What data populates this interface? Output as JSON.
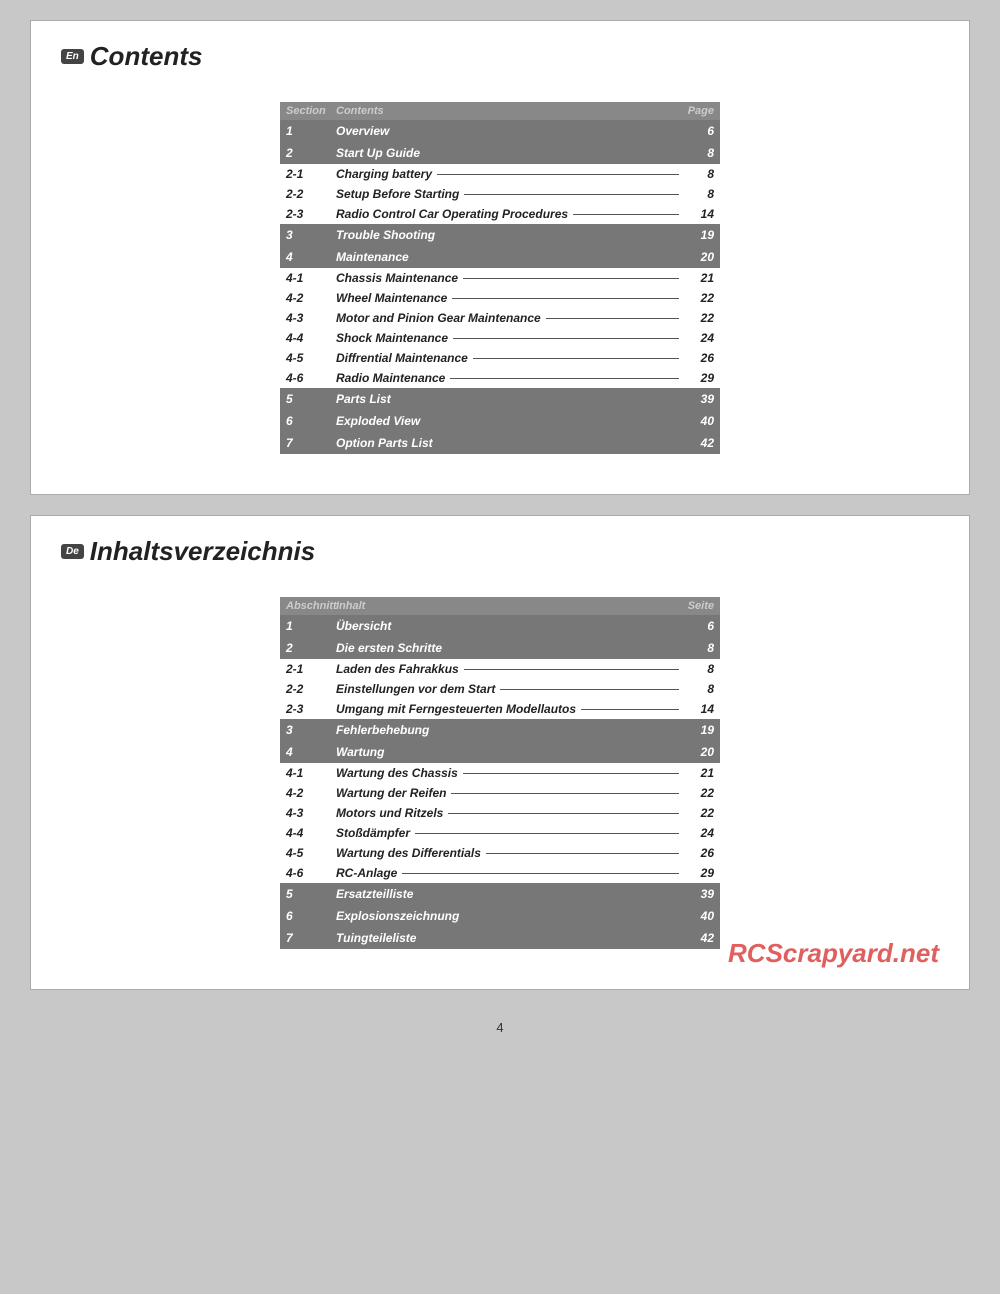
{
  "page_number": "4",
  "english_section": {
    "lang_code": "En",
    "title": "Contents",
    "table": {
      "headers": [
        "Section",
        "Contents",
        "Page"
      ],
      "rows": [
        {
          "section": "1",
          "content": "Overview",
          "page": "6",
          "type": "dark",
          "has_line": false
        },
        {
          "section": "2",
          "content": "Start Up Guide",
          "page": "8",
          "type": "dark",
          "has_line": false
        },
        {
          "section": "2-1",
          "content": "Charging battery",
          "page": "8",
          "type": "light",
          "has_line": true
        },
        {
          "section": "2-2",
          "content": "Setup Before Starting",
          "page": "8",
          "type": "light",
          "has_line": true
        },
        {
          "section": "2-3",
          "content": "Radio Control Car Operating Procedures",
          "page": "14",
          "type": "light",
          "has_line": true
        },
        {
          "section": "3",
          "content": "Trouble Shooting",
          "page": "19",
          "type": "dark",
          "has_line": false
        },
        {
          "section": "4",
          "content": "Maintenance",
          "page": "20",
          "type": "dark",
          "has_line": false
        },
        {
          "section": "4-1",
          "content": "Chassis Maintenance",
          "page": "21",
          "type": "light",
          "has_line": true
        },
        {
          "section": "4-2",
          "content": "Wheel Maintenance",
          "page": "22",
          "type": "light",
          "has_line": true
        },
        {
          "section": "4-3",
          "content": "Motor and Pinion Gear Maintenance",
          "page": "22",
          "type": "light",
          "has_line": true
        },
        {
          "section": "4-4",
          "content": "Shock Maintenance",
          "page": "24",
          "type": "light",
          "has_line": true
        },
        {
          "section": "4-5",
          "content": "Diffrential Maintenance",
          "page": "26",
          "type": "light",
          "has_line": true
        },
        {
          "section": "4-6",
          "content": "Radio Maintenance",
          "page": "29",
          "type": "light",
          "has_line": true
        },
        {
          "section": "5",
          "content": "Parts List",
          "page": "39",
          "type": "dark",
          "has_line": false
        },
        {
          "section": "6",
          "content": "Exploded View",
          "page": "40",
          "type": "dark",
          "has_line": false
        },
        {
          "section": "7",
          "content": "Option Parts List",
          "page": "42",
          "type": "dark",
          "has_line": false
        }
      ]
    }
  },
  "german_section": {
    "lang_code": "De",
    "title": "Inhaltsverzeichnis",
    "table": {
      "headers": [
        "Abschnitt",
        "Inhalt",
        "Seite"
      ],
      "rows": [
        {
          "section": "1",
          "content": "Übersicht",
          "page": "6",
          "type": "dark",
          "has_line": false
        },
        {
          "section": "2",
          "content": "Die ersten Schritte",
          "page": "8",
          "type": "dark",
          "has_line": false
        },
        {
          "section": "2-1",
          "content": "Laden des Fahrakkus",
          "page": "8",
          "type": "light",
          "has_line": true
        },
        {
          "section": "2-2",
          "content": "Einstellungen vor dem Start",
          "page": "8",
          "type": "light",
          "has_line": true
        },
        {
          "section": "2-3",
          "content": "Umgang mit Ferngesteuerten Modellautos",
          "page": "14",
          "type": "light",
          "has_line": true
        },
        {
          "section": "3",
          "content": "Fehlerbehebung",
          "page": "19",
          "type": "dark",
          "has_line": false
        },
        {
          "section": "4",
          "content": "Wartung",
          "page": "20",
          "type": "dark",
          "has_line": false
        },
        {
          "section": "4-1",
          "content": "Wartung des Chassis",
          "page": "21",
          "type": "light",
          "has_line": true
        },
        {
          "section": "4-2",
          "content": "Wartung der Reifen",
          "page": "22",
          "type": "light",
          "has_line": true
        },
        {
          "section": "4-3",
          "content": "Motors und Ritzels",
          "page": "22",
          "type": "light",
          "has_line": true
        },
        {
          "section": "4-4",
          "content": "Stoßdämpfer",
          "page": "24",
          "type": "light",
          "has_line": true
        },
        {
          "section": "4-5",
          "content": "Wartung des Differentials",
          "page": "26",
          "type": "light",
          "has_line": true
        },
        {
          "section": "4-6",
          "content": "RC-Anlage",
          "page": "29",
          "type": "light",
          "has_line": true
        },
        {
          "section": "5",
          "content": "Ersatzteilliste",
          "page": "39",
          "type": "dark",
          "has_line": false
        },
        {
          "section": "6",
          "content": "Explosionszeichnung",
          "page": "40",
          "type": "dark",
          "has_line": false
        },
        {
          "section": "7",
          "content": "Tuingteileliste",
          "page": "42",
          "type": "dark",
          "has_line": false
        }
      ]
    }
  },
  "watermark": "RCScrapyard.net"
}
